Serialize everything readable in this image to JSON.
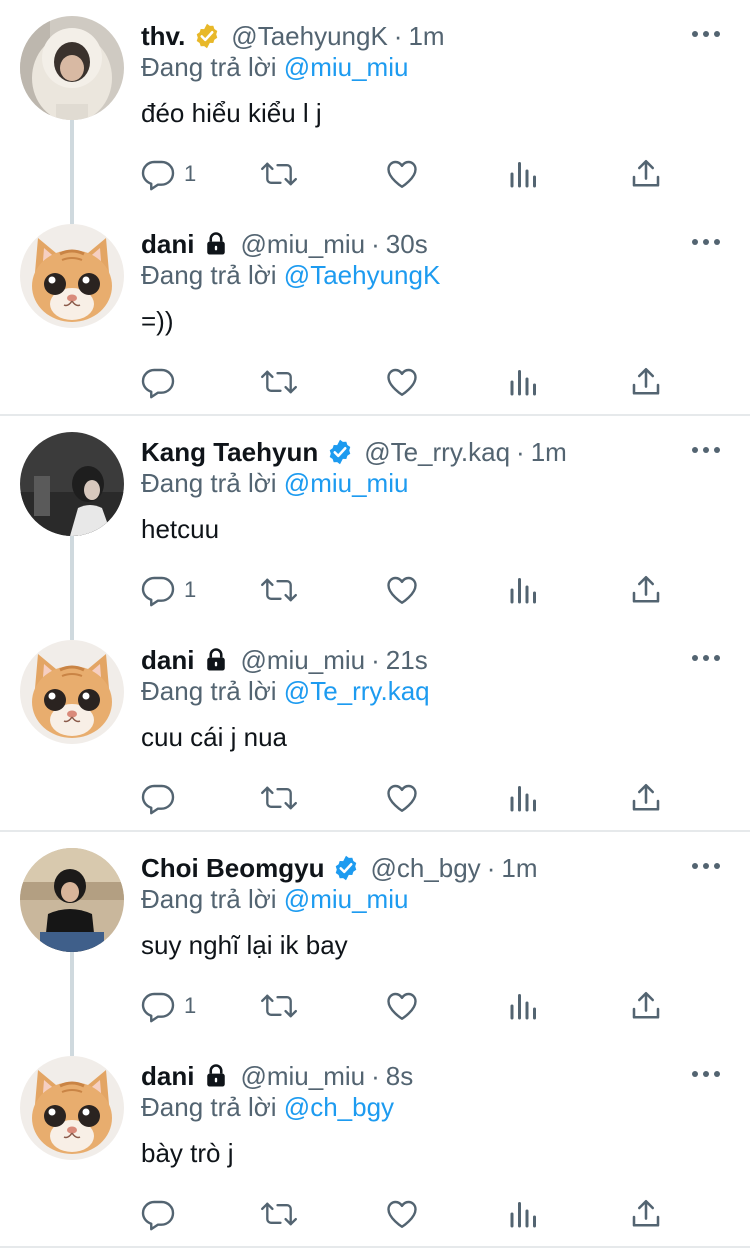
{
  "threads": [
    {
      "parent": {
        "name": "thv.",
        "badge": "gold",
        "handle": "@TaehyungK",
        "time": "1m",
        "reply_prefix": "Đang trả lời",
        "reply_to": "@miu_miu",
        "text": "đéo hiểu kiểu l j",
        "reply_count": "1"
      },
      "reply": {
        "name": "dani",
        "handle": "@miu_miu",
        "time": "30s",
        "reply_prefix": "Đang trả lời",
        "reply_to": "@TaehyungK",
        "text": "=))"
      }
    },
    {
      "parent": {
        "name": "Kang Taehyun",
        "badge": "blue",
        "handle": "@Te_rry.kaq",
        "time": "1m",
        "reply_prefix": "Đang trả lời",
        "reply_to": "@miu_miu",
        "text": "hetcuu",
        "reply_count": "1"
      },
      "reply": {
        "name": "dani",
        "handle": "@miu_miu",
        "time": "21s",
        "reply_prefix": "Đang trả lời",
        "reply_to": "@Te_rry.kaq",
        "text": "cuu cái j nua"
      }
    },
    {
      "parent": {
        "name": "Choi Beomgyu",
        "badge": "blue",
        "handle": "@ch_bgy",
        "time": "1m",
        "reply_prefix": "Đang trả lời",
        "reply_to": "@miu_miu",
        "text": "suy nghĩ lại ik bay",
        "reply_count": "1"
      },
      "reply": {
        "name": "dani",
        "handle": "@miu_miu",
        "time": "8s",
        "reply_prefix": "Đang trả lời",
        "reply_to": "@ch_bgy",
        "text": "bày trò j"
      }
    }
  ],
  "colors": {
    "accent": "#1d9bf0",
    "secondary_text": "#536471",
    "gold_badge": "#e8b829",
    "blue_badge": "#1d9bf0",
    "divider": "#e6e9eb"
  },
  "icons": [
    "reply-icon",
    "retweet-icon",
    "like-icon",
    "views-icon",
    "share-icon",
    "more-icon",
    "verified-badge-icon",
    "lock-icon"
  ]
}
